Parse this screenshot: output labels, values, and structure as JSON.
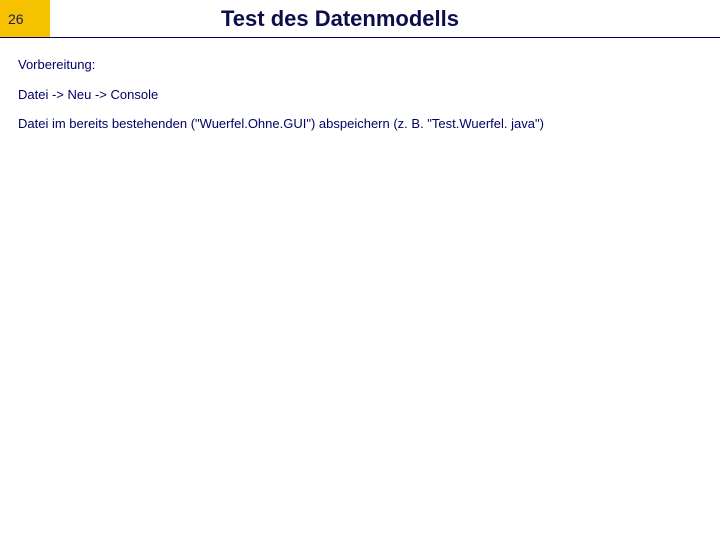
{
  "header": {
    "page_number": "26",
    "title": "Test des Datenmodells"
  },
  "body": {
    "preparation_label": "Vorbereitung:",
    "menu_path": "Datei -> Neu -> Console",
    "save_instruction": "Datei im bereits bestehenden (\"Wuerfel.Ohne.GUI\") abspeichern (z. B. \"Test.Wuerfel. java\")"
  }
}
